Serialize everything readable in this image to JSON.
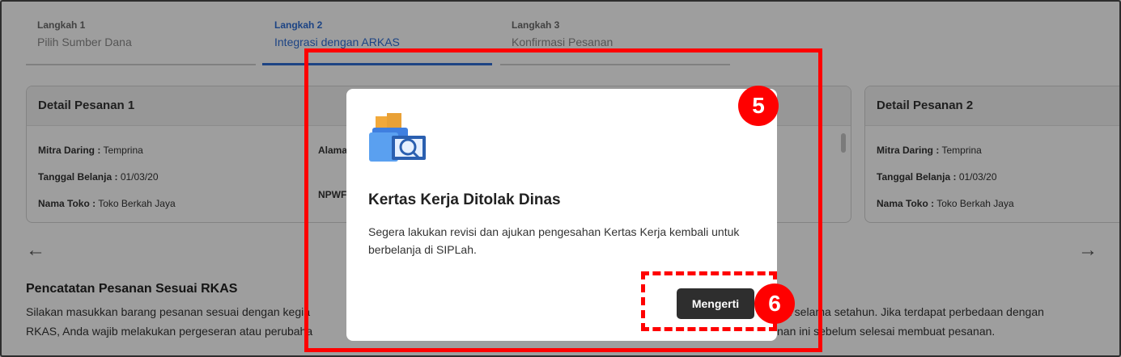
{
  "stepper": {
    "steps": [
      {
        "label": "Langkah 1",
        "name": "Pilih Sumber Dana"
      },
      {
        "label": "Langkah 2",
        "name": "Integrasi dengan ARKAS"
      },
      {
        "label": "Langkah 3",
        "name": "Konfirmasi Pesanan"
      }
    ],
    "active_index": 1,
    "accent_color": "#2f6fd6"
  },
  "orders": {
    "card1": {
      "title": "Detail Pesanan 1",
      "mitra_label": "Mitra Daring :",
      "mitra_value": "Temprina",
      "tanggal_label": "Tanggal Belanja :",
      "tanggal_value": "01/03/20",
      "toko_label": "Nama Toko :",
      "toko_value": "Toko Berkah Jaya",
      "alamat_label_partial": "Alama",
      "npwp_label_partial": "NPWF"
    },
    "card2": {
      "title": "Detail Pesanan 2",
      "mitra_label": "Mitra Daring :",
      "mitra_value": "Temprina",
      "tanggal_label": "Tanggal Belanja :",
      "tanggal_value": "01/03/20",
      "toko_label": "Nama Toko :",
      "toko_value": "Toko Berkah Jaya"
    }
  },
  "nav": {
    "prev_icon": "←",
    "next_icon": "→"
  },
  "section": {
    "title": "Pencatatan Pesanan Sesuai RKAS",
    "line1_left": "Silakan masukkan barang pesanan sesuai dengan kegia",
    "line1_right": "a selama setahun. Jika terdapat perbedaan dengan",
    "line2_left": "RKAS, Anda wajib melakukan pergeseran atau perubaha",
    "line2_right": "nan ini sebelum selesai membuat pesanan."
  },
  "modal": {
    "title": "Kertas Kerja Ditolak Dinas",
    "body": "Segera lakukan revisi dan ajukan pengesahan Kertas Kerja kembali untuk berbelanja di SIPLah.",
    "button": "Mengerti"
  },
  "annotations": {
    "badge_modal": "5",
    "badge_button": "6",
    "color": "#ff0000"
  }
}
